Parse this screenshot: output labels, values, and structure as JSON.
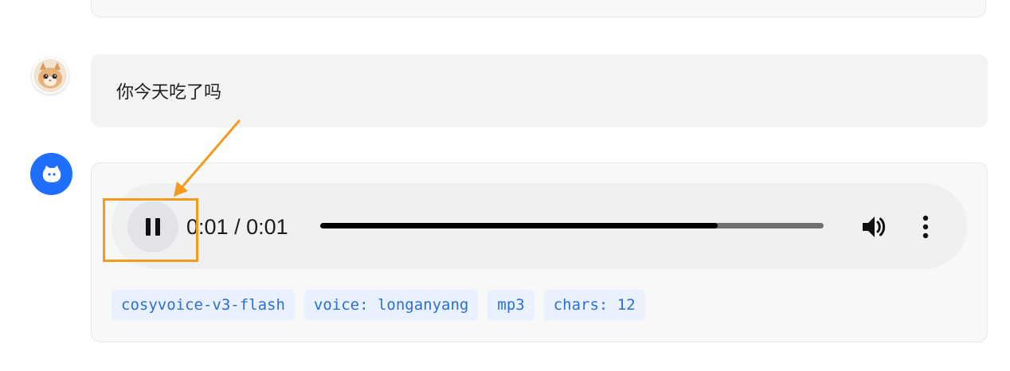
{
  "conversation": {
    "user_message": {
      "text": "你今天吃了吗",
      "avatar_icon": "cat-avatar-icon"
    },
    "bot_message": {
      "avatar_icon": "bot-face-icon",
      "avatar_color": "#1f6fff",
      "audio_player": {
        "state": "playing",
        "current_time": "0:01",
        "separator": " / ",
        "duration": "0:01",
        "time_display": "0:01 / 0:01",
        "progress_fraction": 0.79,
        "play_pause_icon": "pause-icon",
        "volume_icon": "volume-icon",
        "menu_icon": "more-vertical-icon"
      },
      "tags": [
        {
          "label": "cosyvoice-v3-flash"
        },
        {
          "label": "voice: longanyang"
        },
        {
          "label": "mp3"
        },
        {
          "label": "chars: 12"
        }
      ]
    }
  },
  "annotation": {
    "highlight_color": "#f39a1f",
    "target": "pause-button"
  }
}
